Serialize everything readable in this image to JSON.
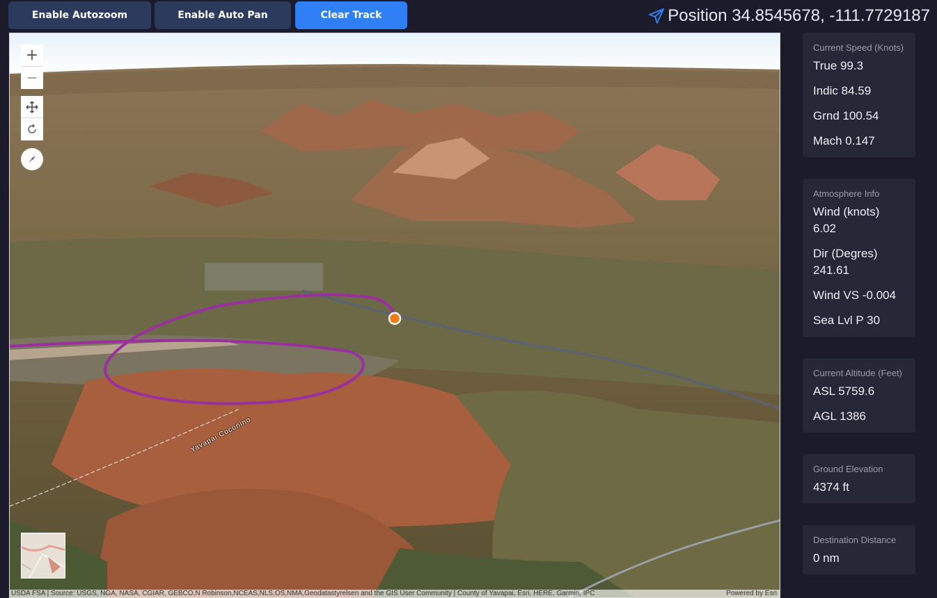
{
  "toolbar": {
    "autozoom_label": "Enable Autozoom",
    "autopan_label": "Enable Auto Pan",
    "clear_track_label": "Clear Track"
  },
  "position": {
    "label": "Position 34.8545678, -111.7729187",
    "icon": "paper-plane-icon",
    "icon_color": "#2f80f5"
  },
  "map": {
    "controls": {
      "zoom_in": "+",
      "zoom_out": "—"
    },
    "road_label": "Yavapai Coconino",
    "attribution": "USDA FSA | Source: USGS, NGA, NASA, CGIAR, GEBCO,N Robinson,NCEAS,NLS,OS,NMA,Geodatastyrelsen and the GIS User Community | County of Yavapai, Esri, HERE, Garmin, IPC",
    "powered_by": "Powered by Esri",
    "track_color": "#9b2fa0",
    "marker_color": "#f07d1a"
  },
  "panels": {
    "speed": {
      "title": "Current Speed (Knots)",
      "rows": [
        "True 99.3",
        "Indic 84.59",
        "Grnd 100.54",
        "Mach 0.147"
      ]
    },
    "atmosphere": {
      "title": "Atmosphere Info",
      "wind_label": "Wind (knots)",
      "wind_value": "6.02",
      "dir_label": "Dir (Degres)",
      "dir_value": "241.61",
      "wind_vs": "Wind VS -0.004",
      "sea_level": "Sea Lvl P 30"
    },
    "altitude": {
      "title": "Current Altitude (Feet)",
      "rows": [
        "ASL 5759.6",
        "AGL 1386"
      ]
    },
    "ground": {
      "title": "Ground Elevation",
      "value": "4374 ft"
    },
    "destination": {
      "title": "Destination Distance",
      "value": "0 nm"
    }
  }
}
